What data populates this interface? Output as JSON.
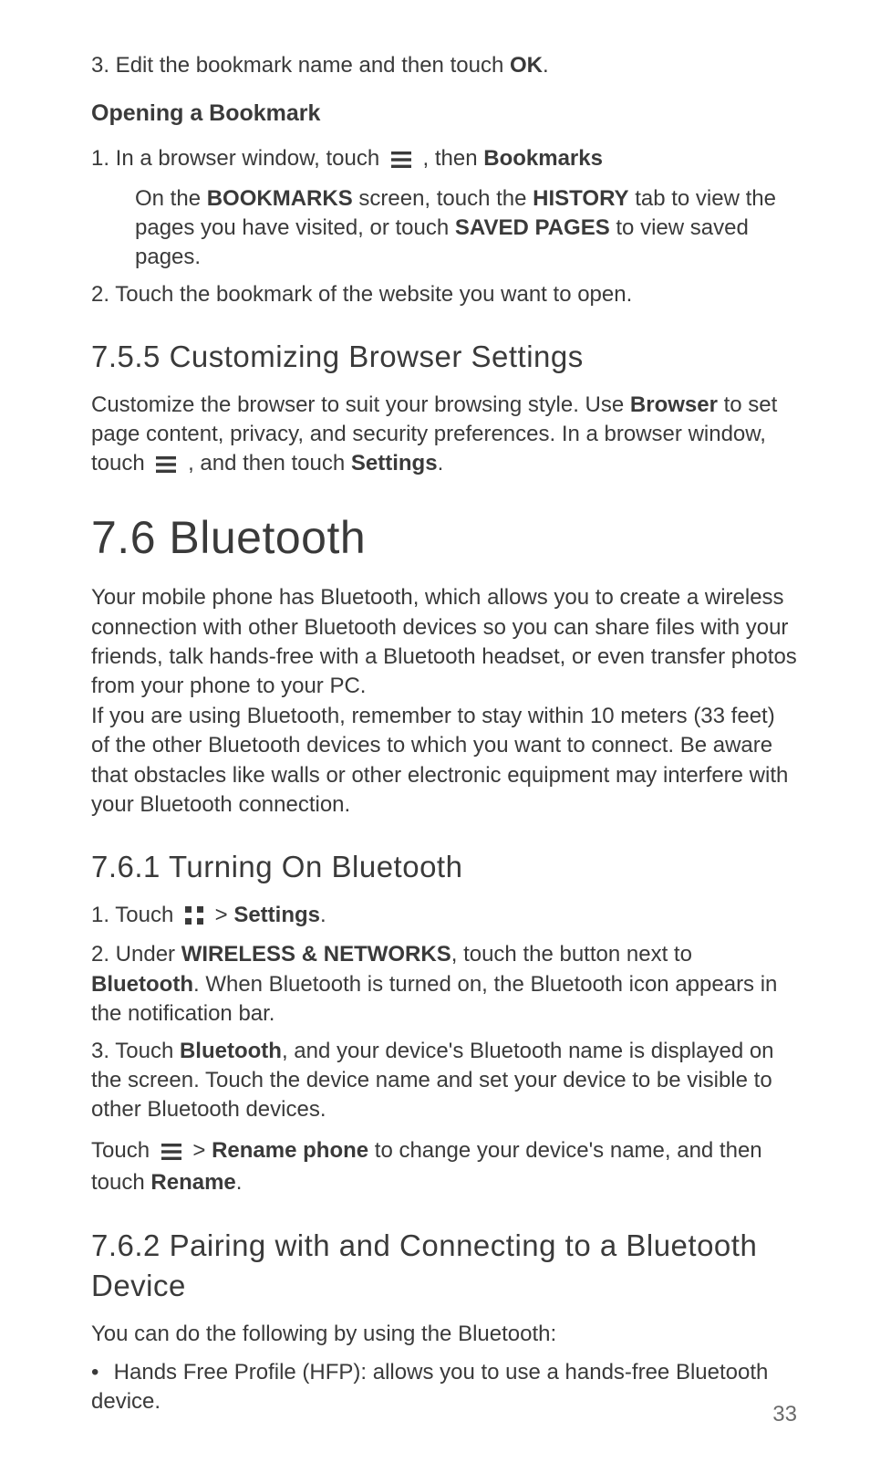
{
  "step3_prefix": "3. Edit the bookmark name and then touch ",
  "step3_bold": "OK",
  "step3_suffix": ".",
  "heading_open_bookmark": "Opening a Bookmark",
  "ob_step1_prefix": "1. In a browser window, touch ",
  "ob_step1_mid": " , then ",
  "ob_step1_bold": "Bookmarks",
  "ob_note_prefix": "On the ",
  "ob_note_b1": "BOOKMARKS",
  "ob_note_mid1": " screen, touch the ",
  "ob_note_b2": "HISTORY",
  "ob_note_mid2": " tab to view the pages you have visited, or touch ",
  "ob_note_b3": "SAVED PAGES",
  "ob_note_suffix": " to view saved pages.",
  "ob_step2": "2. Touch the bookmark of the website you want to open.",
  "heading_755": "7.5.5  Customizing Browser Settings",
  "p755_prefix": "Customize the browser to suit your browsing style. Use ",
  "p755_b1": "Browser",
  "p755_mid1": " to set page content, privacy, and security preferences. In a browser window, touch ",
  "p755_mid2": " , and then touch ",
  "p755_b2": "Settings",
  "p755_suffix": ".",
  "heading_76": "7.6  Bluetooth",
  "p76": "Your mobile phone has Bluetooth, which allows you to create a wireless connection with other Bluetooth devices so you can share files with your friends, talk hands-free with a Bluetooth headset, or even transfer photos from your phone to your PC.\nIf you are using Bluetooth, remember to stay within 10 meters (33 feet) of the other Bluetooth devices to which you want to connect. Be aware that obstacles like walls or other electronic equipment may interfere with your Bluetooth connection.",
  "heading_761": "7.6.1  Turning On Bluetooth",
  "t761_step1_prefix": "1. Touch ",
  "t761_step1_mid": "  > ",
  "t761_step1_bold": "Settings",
  "t761_step1_suffix": ".",
  "t761_step2_prefix": "2. Under ",
  "t761_step2_b1": "WIRELESS & NETWORKS",
  "t761_step2_mid": ", touch the button next to ",
  "t761_step2_b2": "Bluetooth",
  "t761_step2_suffix": ". When Bluetooth is turned on, the Bluetooth icon appears in the notification bar.",
  "t761_step3_prefix": "3. Touch ",
  "t761_step3_b1": "Bluetooth",
  "t761_step3_suffix": ", and your device's Bluetooth name is displayed on the screen. Touch the device name and set your device to be visible to other Bluetooth devices.",
  "t761_note_prefix": "Touch ",
  "t761_note_mid1": "  > ",
  "t761_note_b1": "Rename phone",
  "t761_note_mid2": " to change your device's name, and then touch ",
  "t761_note_b2": "Rename",
  "t761_note_suffix": ".",
  "heading_762": "7.6.2  Pairing with and Connecting to a Bluetooth Device",
  "p762_intro": "You can do the following by using the Bluetooth:",
  "p762_bullet_dot": "•",
  "p762_bullet_text": "Hands Free Profile (HFP): allows you to use a hands-free Bluetooth device.",
  "page_number": "33"
}
